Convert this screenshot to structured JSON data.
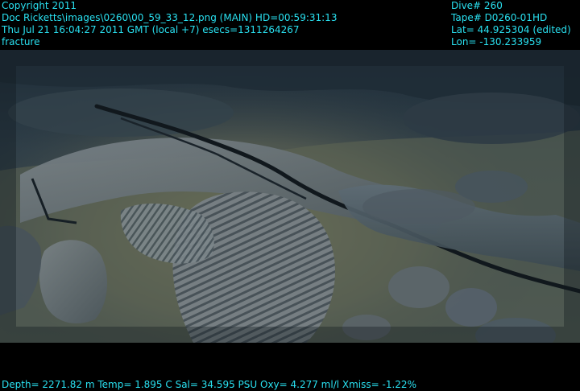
{
  "overlay": {
    "top_left": [
      "Copyright 2011",
      "Doc Ricketts\\images\\0260\\00_59_33_12.png (MAIN)  HD=00:59:31:13",
      "Thu Jul 21 16:04:27 2011 GMT (local +7)  esecs=1311264267",
      "fracture"
    ],
    "top_right": [
      "Dive# 260",
      "Tape# D0260-01HD",
      "Lat= 44.925304 (edited)",
      "Lon= -130.233959"
    ],
    "bottom": "Depth= 2271.82 m  Temp= 1.895 C  Sal= 34.595 PSU  Oxy= 4.277 ml/l  Xmiss= -1.22%"
  },
  "colors": {
    "overlay_text": "#29e0f0",
    "frame_background": "#000000",
    "seafloor_sediment": "#6c6f55",
    "lava_rock": "#65717a",
    "deep_water": "#22313c"
  }
}
